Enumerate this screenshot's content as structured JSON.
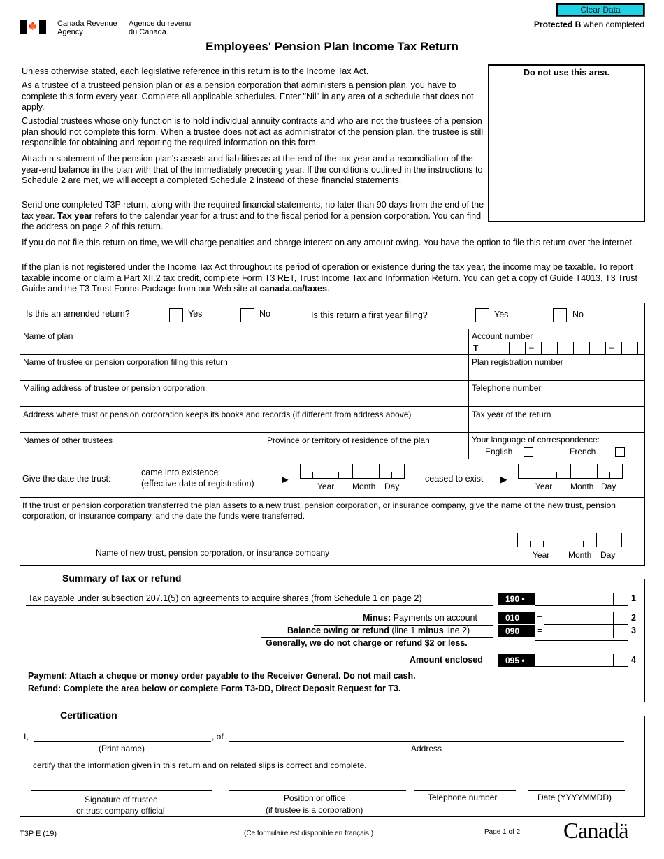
{
  "header": {
    "agency_en_line1": "Canada Revenue",
    "agency_en_line2": "Agency",
    "agency_fr_line1": "Agence du revenu",
    "agency_fr_line2": "du Canada",
    "flag_icon": "maple-leaf",
    "clear_button": "Clear Data",
    "protected_bold": "Protected B",
    "protected_rest": " when completed",
    "title": "Employees' Pension Plan Income Tax Return"
  },
  "do_not_use": "Do not use this area.",
  "intro": {
    "p1": "Unless otherwise stated, each legislative reference in this return is to the Income Tax Act.",
    "p2": "As a trustee of a trusteed pension plan or as a pension corporation that administers a pension plan, you have to complete this form every year. Complete all applicable schedules. Enter \"Nil\" in any area of a schedule that does not apply.",
    "p3": "Custodial trustees whose only function is to hold individual annuity contracts and who are not the trustees of a pension plan should not complete this form. When a trustee does not act as administrator of the pension plan, the trustee is still responsible for obtaining and reporting the required information on this form.",
    "p4": "Attach a statement of the pension plan's assets and liabilities as at the end of the tax year and a reconciliation of the year-end balance in the plan with that of the immediately preceding year. If the conditions outlined in the instructions to Schedule 2 are met, we will accept a completed Schedule 2 instead of these financial statements.",
    "p5_a": "Send one completed T3P return, along with the required financial statements, no later than 90 days from the end of the tax year. ",
    "p5_bold": "Tax year",
    "p5_b": " refers to the calendar year for a trust and to the fiscal period for a pension corporation. You can find the address on page 2 of this return.",
    "p6": "If you do not file this return on time, we will charge penalties and charge interest on any amount owing. You have the option to file this return over the internet.",
    "p7_a": "If the plan is not registered under the Income Tax Act throughout its period of operation or existence during the tax year, the income may be taxable. To report taxable income or claim a Part XII.2 tax credit, complete Form T3 RET, Trust Income Tax and Information Return. You can get a copy of Guide T4013, T3 Trust Guide and the T3 Trust Forms Package from our Web site at ",
    "p7_link": "canada.ca/taxes",
    "p7_end": "."
  },
  "form": {
    "amended_q": "Is this an amended return?",
    "first_year_q": "Is this return a first year filing?",
    "yes": "Yes",
    "no": "No",
    "name_of_plan": "Name of plan",
    "account_number": "Account number",
    "account_prefix": "T",
    "dash": "–",
    "trustee_name": "Name of trustee or pension corporation filing this return",
    "plan_reg": "Plan registration number",
    "mailing_address": "Mailing address of trustee or pension corporation",
    "telephone": "Telephone number",
    "books_address": "Address where trust or pension corporation keeps its books and records (if different from address above)",
    "tax_year": "Tax year of the return",
    "other_trustees": "Names of other trustees",
    "province": "Province or territory of residence of the plan",
    "language": "Your language of correspondence:",
    "english": "English",
    "french": "French",
    "give_date": "Give the date the trust:",
    "came_into_1": "came into existence",
    "came_into_2": "(effective date of registration)",
    "ceased": "ceased to exist",
    "arrow": "▶",
    "year": "Year",
    "month": "Month",
    "day": "Day",
    "transfer_text": "If the trust or pension corporation transferred the plan assets to a new trust, pension corporation, or insurance company, give the name of the new trust, pension corporation, or insurance company, and the date the funds were transferred.",
    "new_trust_label": "Name of new trust, pension corporation, or insurance company"
  },
  "summary": {
    "title": "Summary of tax or refund",
    "line1_text": "Tax payable under subsection 207.1(5) on agreements to acquire shares (from Schedule 1 on page 2)",
    "line1_code": "190 •",
    "line1_num": "1",
    "line2_bold": "Minus:",
    "line2_text": " Payments on account",
    "line2_code": "010",
    "line2_sign": "–",
    "line2_num": "2",
    "line3_bold1": "Balance owing or refund",
    "line3_text1": " (line 1 ",
    "line3_bold2": "minus",
    "line3_text2": " line 2)",
    "line3_code": "090",
    "line3_sign": "=",
    "line3_num": "3",
    "note": "Generally, we do not charge or refund $2 or less.",
    "line4_text": "Amount enclosed",
    "line4_code": "095 •",
    "line4_num": "4",
    "payment": "Payment: Attach a cheque or money order payable to the Receiver General. Do not mail cash.",
    "refund": "Refund: Complete the area below or complete Form T3-DD, Direct Deposit Request for T3."
  },
  "certification": {
    "title": "Certification",
    "i": "I,",
    "of": ", of",
    "print_name": "(Print name)",
    "address": "Address",
    "certify": "certify that the information given in this return and on related slips is correct and complete.",
    "sig1": "Signature of trustee",
    "sig2": "or trust company official",
    "pos1": "Position or office",
    "pos2": "(if trustee is a corporation)",
    "tel": "Telephone number",
    "date": "Date (YYYYMMDD)"
  },
  "footer": {
    "form_id": "T3P E (19)",
    "french_avail": "(Ce formulaire est disponible en français.)",
    "page": "Page 1 of 2",
    "wordmark": "Canadä"
  }
}
